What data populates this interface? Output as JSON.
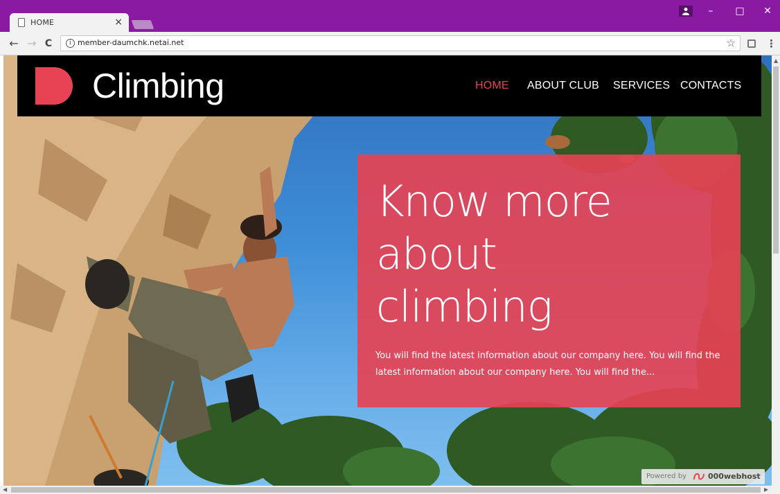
{
  "browser": {
    "tab_title": "HOME",
    "tab_close": "×",
    "url": "member-daumchk.netai.net",
    "window_controls": {
      "minimize": "–",
      "maximize": "□",
      "close": "✕"
    },
    "nav": {
      "back": "←",
      "forward": "→",
      "reload": "C"
    },
    "info_glyph": "i",
    "star_glyph": "☆",
    "menu_glyph": "⋮"
  },
  "site": {
    "brand": "Climbing",
    "nav": [
      {
        "label": "HOME",
        "active": true
      },
      {
        "label": "ABOUT CLUB",
        "active": false
      },
      {
        "label": "SERVICES",
        "active": false
      },
      {
        "label": "CONTACTS",
        "active": false
      }
    ],
    "hero": {
      "title_lines": [
        "Know more",
        "about",
        "climbing"
      ],
      "text": "You will find the latest information about our company here. You will find the latest information about our company here. You will find the..."
    },
    "badge": {
      "label": "Powered by",
      "brand": "000webhost"
    }
  },
  "colors": {
    "titlebar": "#8b1aa3",
    "accent": "#e84354",
    "header_bg": "#000000",
    "hero_card": "#e54354"
  },
  "icons": {
    "favicon": "page-icon",
    "logo": "logo-mark-icon",
    "profile": "person-icon"
  }
}
